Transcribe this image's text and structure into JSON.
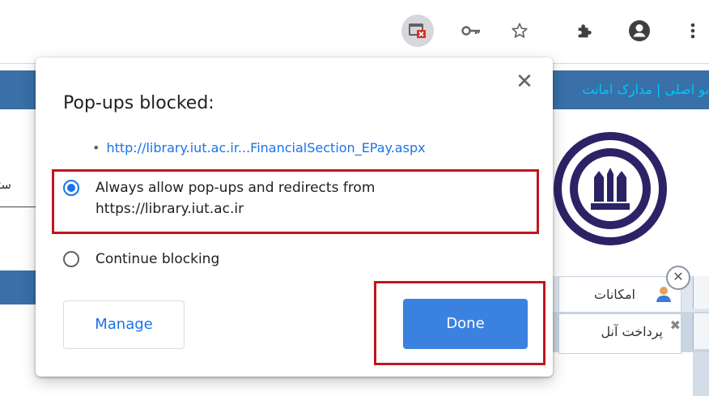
{
  "toolbar": {
    "icons": [
      "popup-blocked-icon",
      "key-icon",
      "star-icon",
      "puzzle-icon",
      "profile-icon",
      "menu-icon"
    ]
  },
  "site": {
    "topbar_text": "نو اصلی | مدارک امانت",
    "left_text": "ستج",
    "tab1_label": "امکانات",
    "tab2_label": "پرداخت آنل"
  },
  "popup": {
    "title": "Pop-ups blocked:",
    "blocked_link": "http://library.iut.ac.ir...FinancialSection_EPay.aspx",
    "options": [
      {
        "label": "Always allow pop-ups and redirects from https://library.iut.ac.ir",
        "checked": true
      },
      {
        "label": "Continue blocking",
        "checked": false
      }
    ],
    "manage_label": "Manage",
    "done_label": "Done"
  },
  "colors": {
    "accent": "#1a73e8",
    "done_button": "#3b82e0",
    "highlight": "#c0161c",
    "site_blue": "#3870a7"
  }
}
